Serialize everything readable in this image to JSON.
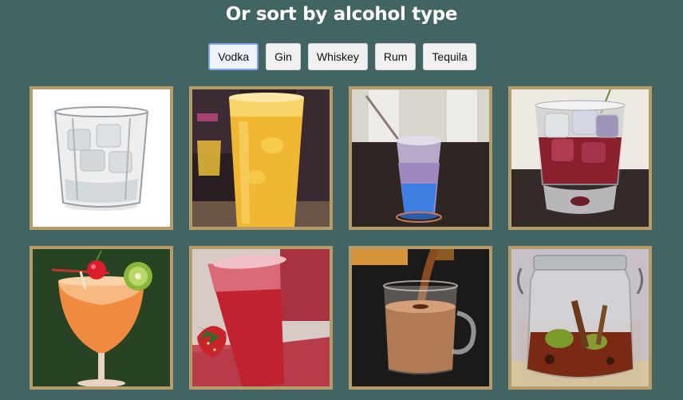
{
  "heading": "Or sort by alcohol type",
  "filters": [
    {
      "label": "Vodka",
      "active": true
    },
    {
      "label": "Gin",
      "active": false
    },
    {
      "label": "Whiskey",
      "active": false
    },
    {
      "label": "Rum",
      "active": false
    },
    {
      "label": "Tequila",
      "active": false
    }
  ],
  "drinks": [
    {
      "image": "clear-drink-rocks-glass"
    },
    {
      "image": "orange-drink-highball-glass"
    },
    {
      "image": "blue-purple-layered-drink-with-straw"
    },
    {
      "image": "red-drink-on-ice-rocks-glass"
    },
    {
      "image": "orange-cocktail-cherry-kiwi-garnish"
    },
    {
      "image": "red-frozen-drink-strawberry-garnish"
    },
    {
      "image": "coffee-liqueur-pour-glass-mug"
    },
    {
      "image": "fruit-infused-liquor-in-jar"
    }
  ]
}
